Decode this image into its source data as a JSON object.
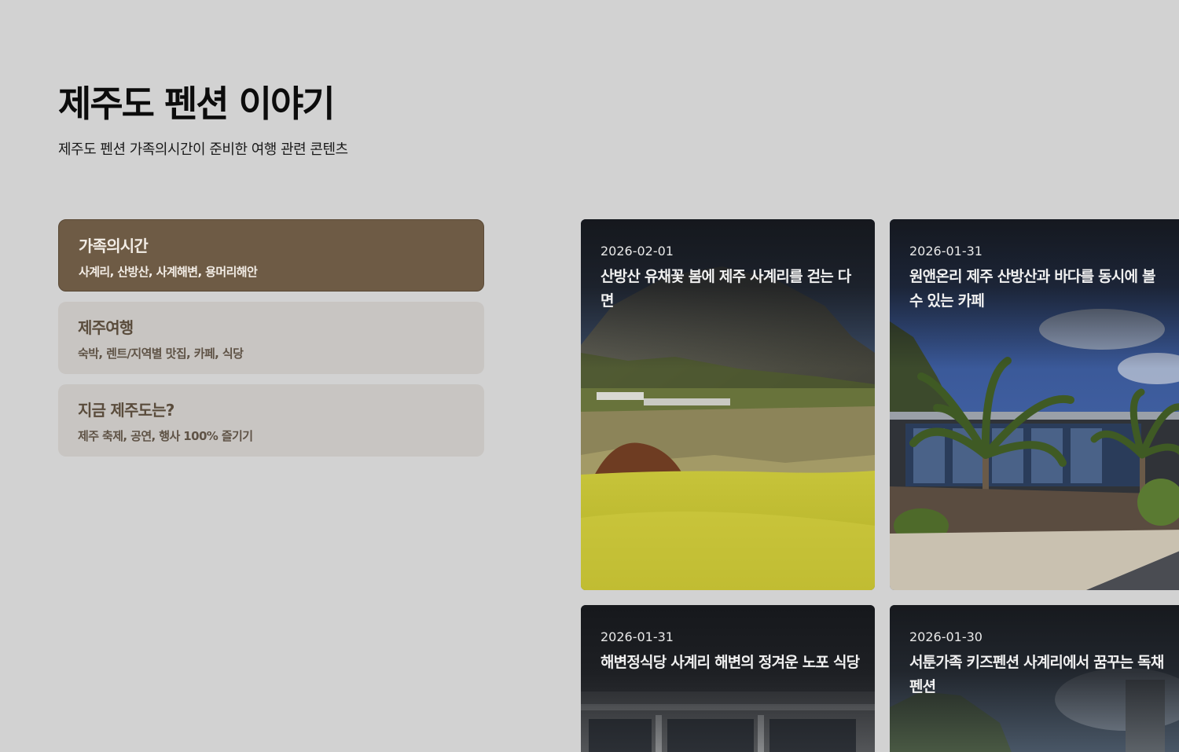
{
  "header": {
    "title": "제주도 펜션 이야기",
    "subtitle": "제주도 펜션 가족의시간이 준비한 여행 관련 콘텐츠"
  },
  "categories": [
    {
      "title": "가족의시간",
      "desc": "사계리, 산방산, 사계해변, 용머리해안",
      "active": true
    },
    {
      "title": "제주여행",
      "desc": "숙박, 렌트/지역별 맛집, 카페, 식당",
      "active": false
    },
    {
      "title": "지금 제주도는?",
      "desc": "제주 축제, 공연, 행사 100% 즐기기",
      "active": false
    }
  ],
  "posts": [
    {
      "date": "2026-02-01",
      "title": "산방산 유채꽃 봄에 제주 사계리를 걷는 다면"
    },
    {
      "date": "2026-01-31",
      "title": "원앤온리 제주 산방산과 바다를 동시에 볼 수 있는 카페"
    },
    {
      "date": "2026-01-31",
      "title": "해변정식당 사계리 해변의 정겨운 노포 식당"
    },
    {
      "date": "2026-01-30",
      "title": "서툰가족 키즈펜션 사계리에서 꿈꾸는 독채펜션"
    }
  ],
  "colors": {
    "background": "#d2d2d2",
    "active_category": "#6e5b45",
    "inactive_category": "#c8c5c2"
  }
}
